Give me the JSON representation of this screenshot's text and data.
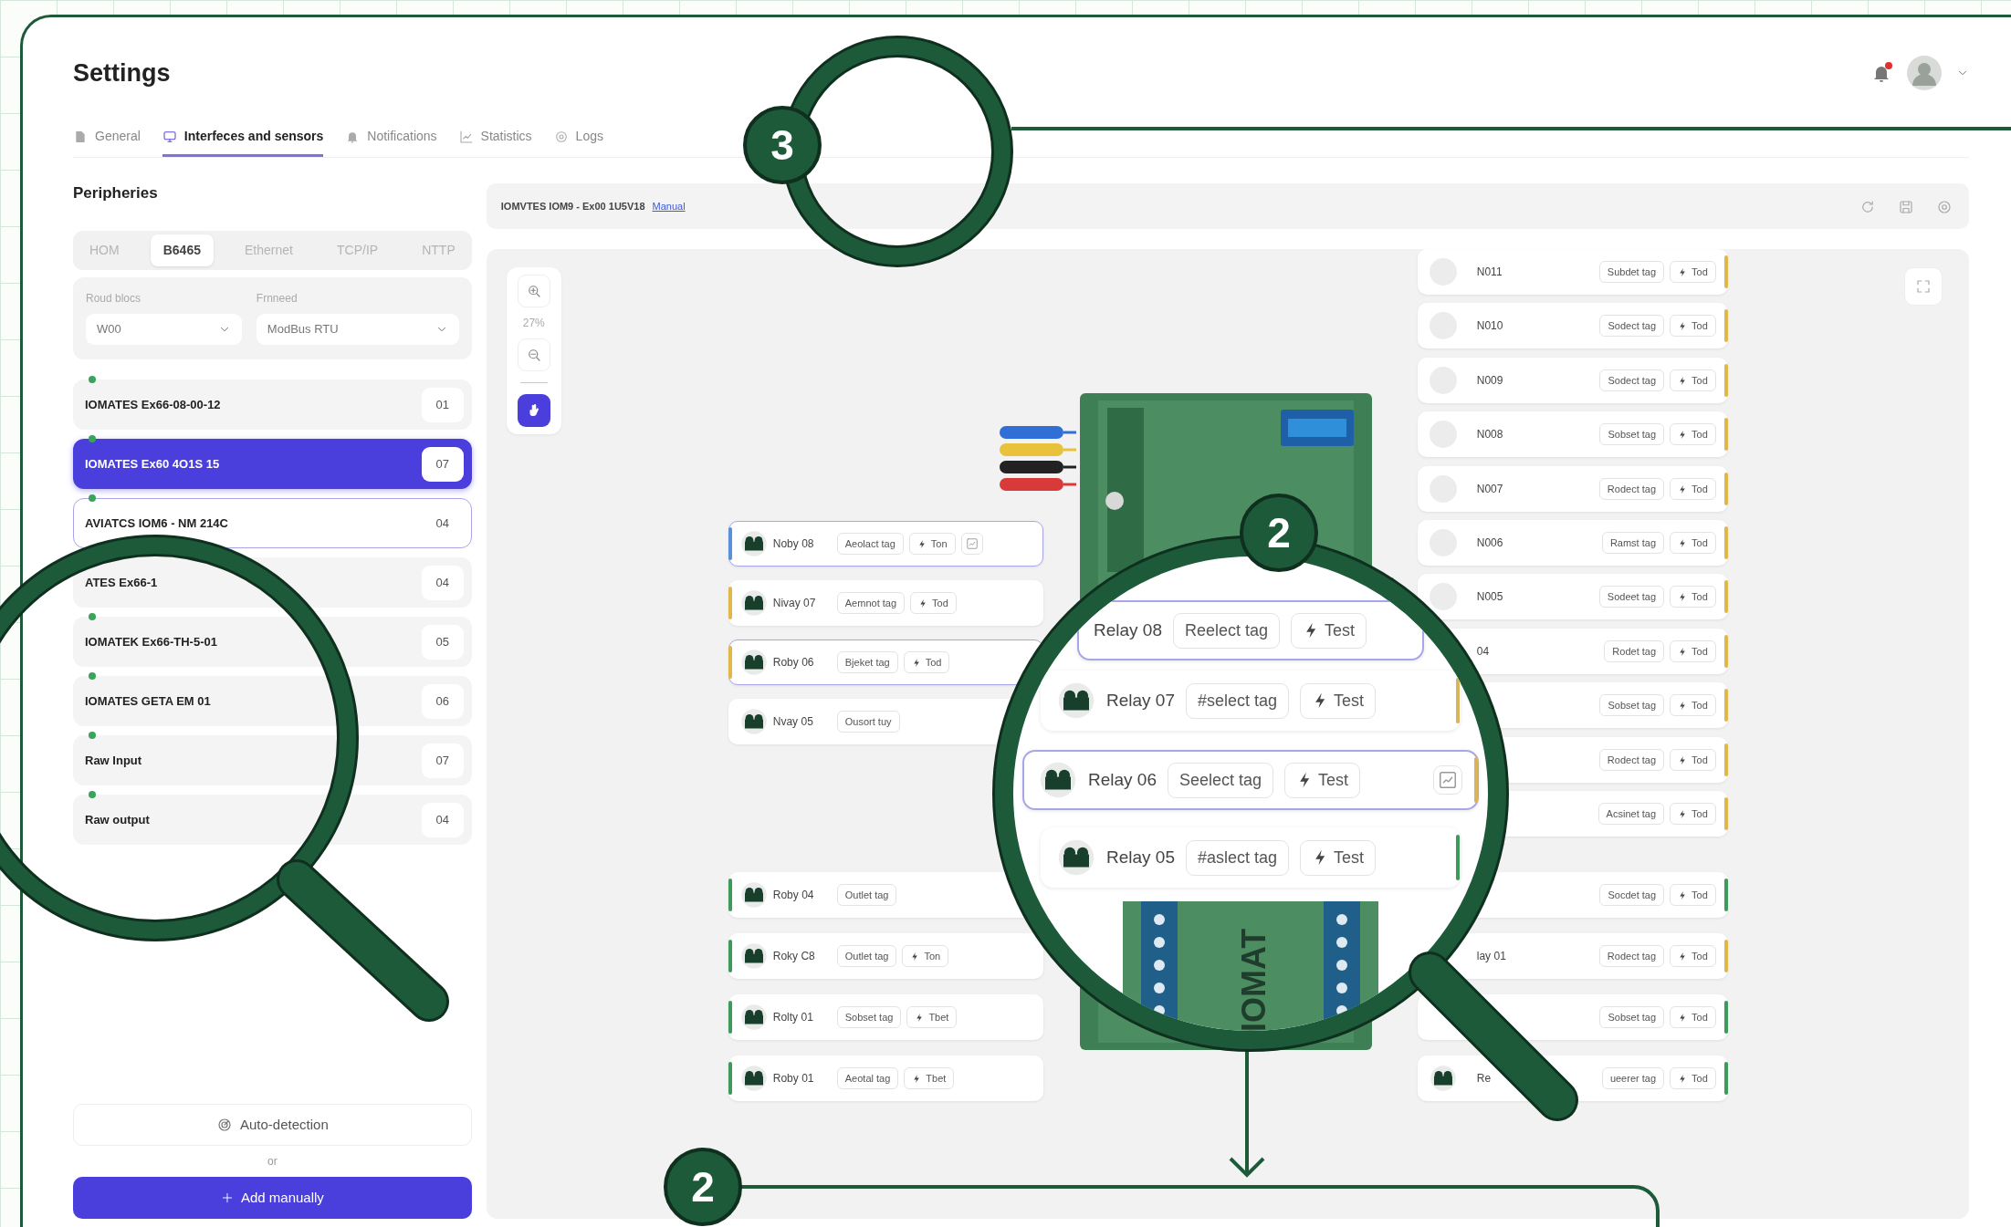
{
  "header": {
    "title": "Settings",
    "unread": true
  },
  "tabs": [
    {
      "label": "General",
      "selected": false
    },
    {
      "label": "Interfeces and sensors",
      "selected": true
    },
    {
      "label": "Notifications",
      "selected": false
    },
    {
      "label": "Statistics",
      "selected": false
    },
    {
      "label": "Logs",
      "selected": false
    }
  ],
  "peripherals": {
    "title": "Peripheries",
    "tabs": [
      {
        "label": "HOM",
        "selected": false
      },
      {
        "label": "B6465",
        "selected": true
      },
      {
        "label": "Ethernet",
        "selected": false
      },
      {
        "label": "TCP/IP",
        "selected": false
      },
      {
        "label": "NTTP",
        "selected": false
      }
    ],
    "fields": [
      {
        "label": "Roud blocs",
        "value": "W00"
      },
      {
        "label": "Frnneed",
        "value": "ModBus RTU"
      }
    ],
    "devices": [
      {
        "label": "IOMATES Ex66-08-00-12",
        "number": "01",
        "selected": false,
        "highlighted": false
      },
      {
        "label": "IOMATES Ex60 4O1S 15",
        "number": "07",
        "selected": true,
        "highlighted": false
      },
      {
        "label": "AVIATCS IOM6 - NM 214C",
        "number": "04",
        "selected": false,
        "highlighted": true
      },
      {
        "label": "ATES Ex66-1",
        "number": "04",
        "selected": false,
        "highlighted": false
      },
      {
        "label": "IOMATEK Ex66-TH-5-01",
        "number": "05",
        "selected": false,
        "highlighted": false
      },
      {
        "label": "IOMATES GETA  EM 01",
        "number": "06",
        "selected": false,
        "highlighted": false
      },
      {
        "label": "Raw Input",
        "number": "07",
        "selected": false,
        "highlighted": false
      },
      {
        "label": "Raw output",
        "number": "04",
        "selected": false,
        "highlighted": false
      }
    ],
    "auto_detect": "Auto-detection",
    "separator": "or",
    "add": "Add manually"
  },
  "canvas": {
    "title": "IOMVTES IOM9 - Ex00 1U5V18",
    "link": "Manual",
    "zoom": "27%",
    "wires": [
      {
        "color": "#2f6fd6"
      },
      {
        "color": "#e8c23a"
      },
      {
        "color": "#222222"
      },
      {
        "color": "#d83a3a"
      }
    ],
    "left_groups": [
      {
        "cards": [
          {
            "kind": "relay",
            "label": "Noby 08",
            "tag": "Aeolact tag",
            "test": "Ton",
            "chart": true,
            "selected": true,
            "color": "#5b8fd9"
          },
          {
            "kind": "relay",
            "label": "Nivay 07",
            "tag": "Aemnot tag",
            "test": "Tod",
            "selected": false,
            "color": "#e0b84a"
          },
          {
            "kind": "relay",
            "label": "Roby 06",
            "tag": "Bjeket tag",
            "test": "Tod",
            "selected": true,
            "color": "#e0b84a"
          },
          {
            "kind": "relay",
            "label": "Nvay 05",
            "tag": "Ousort tuy",
            "selected": false
          }
        ]
      },
      {
        "cards": [
          {
            "kind": "relay",
            "label": "Roby 04",
            "tag": "Outlet tag",
            "selected": false,
            "color": "#3d9a5b"
          },
          {
            "kind": "relay",
            "label": "Roky C8",
            "tag": "Outlet tag",
            "test": "Ton",
            "selected": false,
            "color": "#3d9a5b"
          },
          {
            "kind": "relay",
            "label": "Rolty 01",
            "tag": "Sobset tag",
            "test": "Tbet",
            "selected": false,
            "color": "#3d9a5b"
          },
          {
            "kind": "relay",
            "label": "Roby 01",
            "tag": "Aeotal tag",
            "test": "Tbet",
            "selected": false,
            "color": "#3d9a5b"
          }
        ]
      }
    ],
    "right_groups": [
      {
        "cards": [
          {
            "kind": "sensor",
            "label": "N011",
            "tag": "Subdet tag",
            "test": "Tod",
            "color": "#e0b84a"
          },
          {
            "kind": "sensor",
            "label": "N010",
            "tag": "Sodect tag",
            "test": "Tod",
            "color": "#e0b84a"
          },
          {
            "kind": "sensor",
            "label": "N009",
            "tag": "Sodect tag",
            "test": "Tod",
            "color": "#e0b84a"
          },
          {
            "kind": "sensor",
            "label": "N008",
            "tag": "Sobset tag",
            "test": "Tod",
            "color": "#e0b84a"
          },
          {
            "kind": "sensor",
            "label": "N007",
            "tag": "Rodect tag",
            "test": "Tod",
            "color": "#e0b84a"
          },
          {
            "kind": "sensor",
            "label": "N006",
            "tag": "Ramst tag",
            "test": "Tod",
            "color": "#e0b84a"
          },
          {
            "kind": "sensor",
            "label": "N005",
            "tag": "Sodeet tag",
            "test": "Tod",
            "color": "#e0b84a"
          },
          {
            "kind": "plain",
            "label": "04",
            "tag": "Rodet tag",
            "test": "Tod",
            "color": "#e0b84a"
          },
          {
            "kind": "plain",
            "tag": "Sobset tag",
            "test": "Tod",
            "color": "#e0b84a"
          },
          {
            "kind": "plain",
            "tag": "Rodect tag",
            "test": "Tod",
            "color": "#e0b84a"
          },
          {
            "kind": "plain",
            "tag": "Acsinet tag",
            "test": "Tod",
            "color": "#e0b84a"
          }
        ]
      },
      {
        "cards": [
          {
            "kind": "plain",
            "tag": "Socdet tag",
            "test": "Tod",
            "color": "#3d9a5b"
          },
          {
            "kind": "plain",
            "label": "lay 01",
            "tag": "Rodect tag",
            "test": "Tod",
            "color": "#e0b84a"
          },
          {
            "kind": "plain",
            "tag": "Sobset tag",
            "test": "Tod",
            "color": "#3d9a5b"
          },
          {
            "kind": "relay",
            "label": "Re",
            "tag": "ueerer tag",
            "test": "Tod",
            "color": "#3d9a5b"
          }
        ]
      }
    ]
  },
  "callout_3": {
    "badge": "3"
  },
  "magnifier_2": {
    "badge": "2",
    "device_text": "IOMAT",
    "cards": [
      {
        "kind": "plain",
        "label": "Relay 08",
        "tag": "Reelect tag",
        "test": "Test",
        "selected": true
      },
      {
        "kind": "relay",
        "label": "Relay 07",
        "tag": "#select tag",
        "test": "Test",
        "selected": false,
        "color": "#d9b45a"
      },
      {
        "kind": "relay",
        "label": "Relay 06",
        "tag": "Seelect tag",
        "test": "Test",
        "chart": true,
        "selected": true,
        "color": "#d9b45a"
      },
      {
        "kind": "relay",
        "label": "Relay 05",
        "tag": "#aslect tag",
        "test": "Test",
        "selected": false,
        "color": "#3d9a5b"
      }
    ]
  },
  "callout_2": {
    "badge": "2"
  }
}
